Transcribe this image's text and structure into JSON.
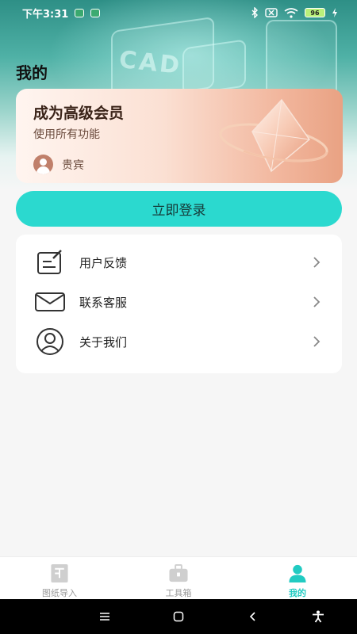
{
  "status_bar": {
    "time": "下午3:31",
    "battery": "96"
  },
  "hero": {
    "bg_text": "CAD"
  },
  "page": {
    "title": "我的"
  },
  "vip_card": {
    "title": "成为高级会员",
    "subtitle": "使用所有功能",
    "user_label": "贵宾",
    "gradient_colors": [
      "#fff5f0",
      "#e9a283"
    ]
  },
  "login_button": {
    "label": "立即登录",
    "color": "#2bd9cf"
  },
  "menu": {
    "items": [
      {
        "label": "用户反馈",
        "icon": "feedback-edit-icon"
      },
      {
        "label": "联系客服",
        "icon": "mail-icon"
      },
      {
        "label": "关于我们",
        "icon": "user-circle-icon"
      }
    ]
  },
  "tab_bar": {
    "active_color": "#21cbc2",
    "tabs": [
      {
        "label": "图纸导入",
        "icon": "drawing-import-icon",
        "active": false
      },
      {
        "label": "工具箱",
        "icon": "toolbox-icon",
        "active": false
      },
      {
        "label": "我的",
        "icon": "person-icon",
        "active": true
      }
    ]
  },
  "nav_bar": {
    "buttons": [
      "menu-icon",
      "home-icon",
      "back-icon",
      "accessibility-icon"
    ]
  }
}
